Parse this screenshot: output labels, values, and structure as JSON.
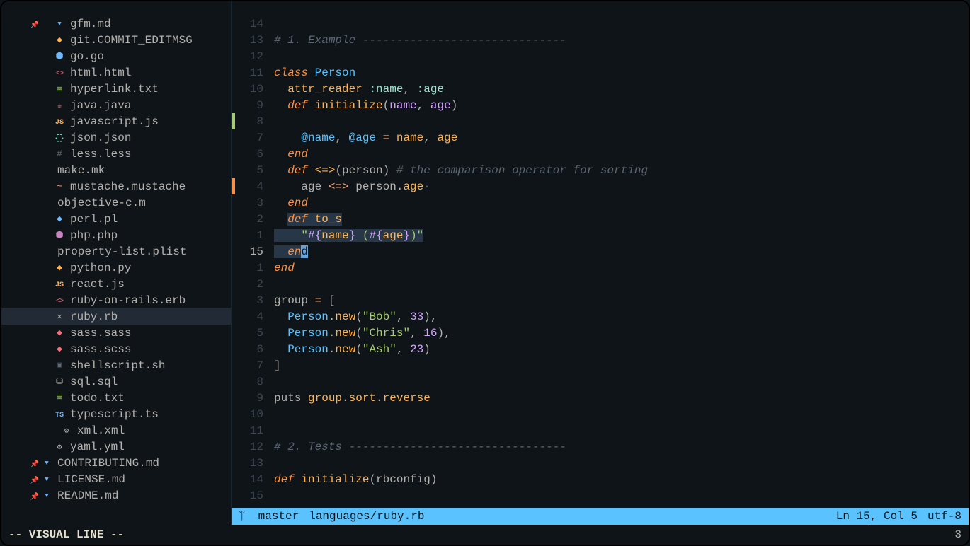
{
  "sidebar": {
    "files": [
      {
        "icon": "md",
        "name": "gfm.md",
        "pin": true
      },
      {
        "icon": "git",
        "name": "git.COMMIT_EDITMSG"
      },
      {
        "icon": "go",
        "name": "go.go"
      },
      {
        "icon": "html",
        "name": "html.html"
      },
      {
        "icon": "txt",
        "name": "hyperlink.txt"
      },
      {
        "icon": "java",
        "name": "java.java"
      },
      {
        "icon": "js",
        "name": "javascript.js"
      },
      {
        "icon": "json",
        "name": "json.json"
      },
      {
        "icon": "less",
        "name": "less.less"
      },
      {
        "icon": "none",
        "name": "make.mk",
        "level": 0
      },
      {
        "icon": "must",
        "name": "mustache.mustache"
      },
      {
        "icon": "none",
        "name": "objective-c.m",
        "level": 0
      },
      {
        "icon": "perl",
        "name": "perl.pl"
      },
      {
        "icon": "php",
        "name": "php.php"
      },
      {
        "icon": "none",
        "name": "property-list.plist",
        "level": 0
      },
      {
        "icon": "py",
        "name": "python.py"
      },
      {
        "icon": "js",
        "name": "react.js"
      },
      {
        "icon": "erb",
        "name": "ruby-on-rails.erb"
      },
      {
        "icon": "close",
        "name": "ruby.rb",
        "active": true
      },
      {
        "icon": "sass",
        "name": "sass.sass"
      },
      {
        "icon": "sass",
        "name": "sass.scss"
      },
      {
        "icon": "sh",
        "name": "shellscript.sh"
      },
      {
        "icon": "sql",
        "name": "sql.sql"
      },
      {
        "icon": "txt",
        "name": "todo.txt"
      },
      {
        "icon": "ts",
        "name": "typescript.ts"
      },
      {
        "icon": "xml",
        "name": "xml.xml",
        "indent": 1
      },
      {
        "icon": "yaml",
        "name": "yaml.yml"
      },
      {
        "icon": "md",
        "name": "CONTRIBUTING.md",
        "level": 0,
        "pin": true
      },
      {
        "icon": "md",
        "name": "LICENSE.md",
        "level": 0,
        "pin": true
      },
      {
        "icon": "md",
        "name": "README.md",
        "level": 0,
        "pin": true
      }
    ]
  },
  "editor": {
    "lines": [
      {
        "num": "14",
        "tokens": []
      },
      {
        "num": "13",
        "tokens": [
          [
            "# 1. Example ------------------------------",
            "comment"
          ]
        ]
      },
      {
        "num": "12",
        "tokens": []
      },
      {
        "num": "11",
        "tokens": [
          [
            "class",
            "keyword"
          ],
          [
            " "
          ],
          [
            "Person",
            "const"
          ]
        ]
      },
      {
        "num": "10",
        "tokens": [
          [
            "  "
          ],
          [
            "attr_reader",
            "func"
          ],
          [
            " "
          ],
          [
            ":name",
            "symbol"
          ],
          [
            ","
          ],
          [
            " "
          ],
          [
            ":age",
            "symbol"
          ]
        ]
      },
      {
        "num": "9",
        "tokens": [
          [
            "  "
          ],
          [
            "def",
            "keyword"
          ],
          [
            " "
          ],
          [
            "initialize",
            "def"
          ],
          [
            "("
          ],
          [
            "name",
            "param"
          ],
          [
            ","
          ],
          [
            " "
          ],
          [
            "age",
            "param"
          ],
          [
            ")"
          ]
        ]
      },
      {
        "num": "8",
        "gutter": "green",
        "tokens": []
      },
      {
        "num": "7",
        "tokens": [
          [
            "    "
          ],
          [
            "@name",
            "ivar"
          ],
          [
            ","
          ],
          [
            " "
          ],
          [
            "@age",
            "ivar"
          ],
          [
            " "
          ],
          [
            "=",
            "op"
          ],
          [
            " "
          ],
          [
            "name",
            "func"
          ],
          [
            ","
          ],
          [
            " "
          ],
          [
            "age",
            "func"
          ]
        ]
      },
      {
        "num": "6",
        "tokens": [
          [
            "  "
          ],
          [
            "end",
            "keyword"
          ]
        ]
      },
      {
        "num": "5",
        "tokens": [
          [
            "  "
          ],
          [
            "def",
            "keyword"
          ],
          [
            " "
          ],
          [
            "<=>",
            "def"
          ],
          [
            "(person) "
          ],
          [
            "# the comparison operator for sorting",
            "comment"
          ]
        ]
      },
      {
        "num": "4",
        "gutter": "orange",
        "tokens": [
          [
            "    age "
          ],
          [
            "<=>",
            "op"
          ],
          [
            " "
          ],
          [
            "person",
            "ident"
          ],
          [
            "."
          ],
          [
            "age",
            "func"
          ],
          [
            "·",
            "dim"
          ]
        ]
      },
      {
        "num": "3",
        "tokens": [
          [
            "  "
          ],
          [
            "end",
            "keyword"
          ]
        ]
      },
      {
        "num": "2",
        "sel": true,
        "tokens": [
          [
            "  "
          ],
          [
            "__SEL__"
          ],
          [
            "def",
            "keyword"
          ],
          [
            " "
          ],
          [
            "to_s",
            "def"
          ]
        ]
      },
      {
        "num": "1",
        "sel": true,
        "tokens": [
          [
            "    "
          ],
          [
            "\"",
            "string"
          ],
          [
            "#{",
            "interp"
          ],
          [
            "name",
            "func"
          ],
          [
            "}",
            "interp"
          ],
          [
            " (",
            "string"
          ],
          [
            "#{",
            "interp"
          ],
          [
            "age",
            "func"
          ],
          [
            "}",
            "interp"
          ],
          [
            ")\"",
            "string"
          ]
        ]
      },
      {
        "num": "15",
        "current": true,
        "sel": true,
        "tokens": [
          [
            "  "
          ],
          [
            "en",
            "keyword"
          ],
          [
            "__CUR__",
            "d"
          ]
        ]
      },
      {
        "num": "1",
        "tokens": [
          [
            "end",
            "keyword"
          ]
        ]
      },
      {
        "num": "2",
        "tokens": []
      },
      {
        "num": "3",
        "tokens": [
          [
            "group",
            "ident"
          ],
          [
            " "
          ],
          [
            "=",
            "op"
          ],
          [
            " ["
          ]
        ]
      },
      {
        "num": "4",
        "tokens": [
          [
            "  "
          ],
          [
            "Person",
            "const"
          ],
          [
            "."
          ],
          [
            "new",
            "func"
          ],
          [
            "("
          ],
          [
            "\"Bob\"",
            "string"
          ],
          [
            ","
          ],
          [
            " "
          ],
          [
            "33",
            "number"
          ],
          [
            "),"
          ]
        ]
      },
      {
        "num": "5",
        "tokens": [
          [
            "  "
          ],
          [
            "Person",
            "const"
          ],
          [
            "."
          ],
          [
            "new",
            "func"
          ],
          [
            "("
          ],
          [
            "\"Chris\"",
            "string"
          ],
          [
            ","
          ],
          [
            " "
          ],
          [
            "16",
            "number"
          ],
          [
            "),"
          ]
        ]
      },
      {
        "num": "6",
        "tokens": [
          [
            "  "
          ],
          [
            "Person",
            "const"
          ],
          [
            "."
          ],
          [
            "new",
            "func"
          ],
          [
            "("
          ],
          [
            "\"Ash\"",
            "string"
          ],
          [
            ","
          ],
          [
            " "
          ],
          [
            "23",
            "number"
          ],
          [
            ")"
          ]
        ]
      },
      {
        "num": "7",
        "tokens": [
          [
            "]"
          ]
        ]
      },
      {
        "num": "8",
        "tokens": []
      },
      {
        "num": "9",
        "tokens": [
          [
            "puts",
            "ident"
          ],
          [
            " "
          ],
          [
            "group",
            "func"
          ],
          [
            "."
          ],
          [
            "sort",
            "func"
          ],
          [
            "."
          ],
          [
            "reverse",
            "func"
          ]
        ]
      },
      {
        "num": "10",
        "tokens": []
      },
      {
        "num": "11",
        "tokens": []
      },
      {
        "num": "12",
        "tokens": [
          [
            "# 2. Tests --------------------------------",
            "comment"
          ]
        ]
      },
      {
        "num": "13",
        "tokens": []
      },
      {
        "num": "14",
        "tokens": [
          [
            "def",
            "keyword"
          ],
          [
            " "
          ],
          [
            "initialize",
            "def"
          ],
          [
            "(rbconfig)"
          ]
        ]
      },
      {
        "num": "15",
        "tokens": []
      }
    ]
  },
  "status": {
    "branch": "master",
    "path": "languages/ruby.rb",
    "position": "Ln 15, Col 5",
    "encoding": "utf-8"
  },
  "cmdline": {
    "mode": "-- VISUAL LINE --",
    "count": "3"
  }
}
